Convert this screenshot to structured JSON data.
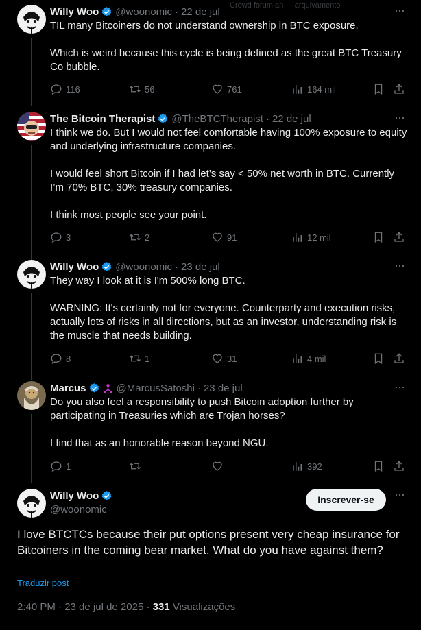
{
  "overlay": {
    "text": "Crowd forum an  · · arquivamento"
  },
  "tweets": [
    {
      "name": "Willy Woo",
      "handle": "@woonomic",
      "sep": "·",
      "date": "22 de jul",
      "paragraphs": [
        "TIL many Bitcoiners do not understand ownership in BTC exposure.",
        "Which is weird because this cycle is being defined as the great BTC Treasury Co bubble."
      ],
      "replies": "116",
      "retweets": "56",
      "likes": "761",
      "views": "164 mil"
    },
    {
      "name": "The Bitcoin Therapist",
      "handle": "@TheBTCTherapist",
      "sep": "·",
      "date": "22 de jul",
      "paragraphs": [
        "I think we do. But I would not feel comfortable having 100% exposure to equity and underlying infrastructure companies.",
        "I would feel short Bitcoin if I had let’s say < 50% net worth in BTC. Currently I’m 70% BTC, 30% treasury companies.",
        "I think most people see your point."
      ],
      "replies": "3",
      "retweets": "2",
      "likes": "91",
      "views": "12 mil"
    },
    {
      "name": "Willy Woo",
      "handle": "@woonomic",
      "sep": "·",
      "date": "23 de jul",
      "paragraphs": [
        "They way I look at it is I'm 500% long BTC.",
        "WARNING: It's certainly not for everyone. Counterparty and execution risks, actually lots of risks in all directions, but as an investor, understanding risk is the muscle that needs building."
      ],
      "replies": "8",
      "retweets": "1",
      "likes": "31",
      "views": "4 mil"
    },
    {
      "name": "Marcus",
      "handle": "@MarcusSatoshi",
      "sep": "·",
      "date": "23 de jul",
      "paragraphs": [
        "Do you also feel a responsibility to push Bitcoin adoption further by participating in Treasuries which are Trojan horses?",
        "I find that as an honorable reason beyond NGU."
      ],
      "replies": "1",
      "retweets": "",
      "likes": "",
      "views": "392"
    }
  ],
  "main": {
    "name": "Willy Woo",
    "handle": "@woonomic",
    "subscribe_label": "Inscrever-se",
    "text": "I love BTCTCs because their put options present very cheap insurance for Bitcoiners in the coming bear market. What do you have against them?",
    "translate_label": "Traduzir post",
    "time": "2:40 PM · 23 de jul de 2025 · ",
    "views_count": "331",
    "views_label": " Visualizações"
  },
  "icons": {
    "more": "more-icon",
    "reply": "reply-icon",
    "retweet": "retweet-icon",
    "like": "like-icon",
    "views": "views-icon",
    "bookmark": "bookmark-icon",
    "share": "share-icon",
    "verified": "verified-badge-icon",
    "affiliate": "affiliate-badge-icon"
  },
  "colors": {
    "background": "#000000",
    "text": "#e7e9ea",
    "muted": "#71767b",
    "accent": "#1d9bf0",
    "affiliate": "#c936cc"
  }
}
